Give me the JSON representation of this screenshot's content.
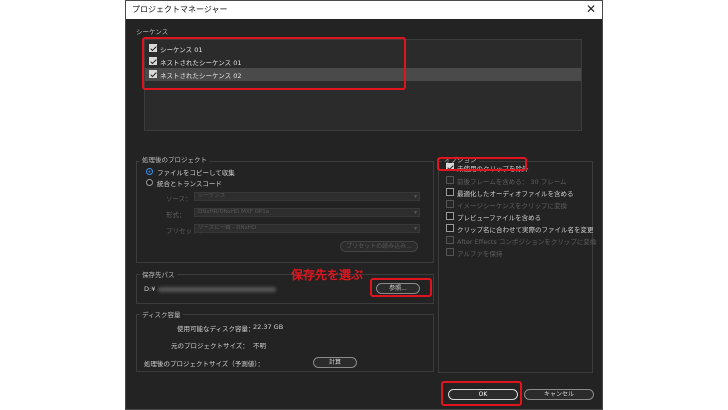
{
  "window": {
    "title": "プロジェクトマネージャー",
    "close_glyph": "✕"
  },
  "sequences": {
    "label": "シーケンス",
    "items": [
      {
        "label": "シーケンス 01",
        "checked": true
      },
      {
        "label": "ネストされたシーケンス 01",
        "checked": true
      },
      {
        "label": "ネストされたシーケンス 02",
        "checked": true,
        "selected": true
      }
    ]
  },
  "processed_project": {
    "label": "処理後のプロジェクト",
    "radio_copy": "ファイルをコピーして収集",
    "radio_consolidate": "統合とトランスコード",
    "source_label": "ソース：",
    "source_value": "シーケンス",
    "format_label": "形式：",
    "format_value": "DNxHR/DNxHD MXF OP1a",
    "preset_label": "プリセット：",
    "preset_value": "ソースに一致 - DNxHD",
    "import_preset_button": "プリセットの読み込み..."
  },
  "options": {
    "label": "オプション",
    "items": [
      {
        "label": "未使用のクリップを除外",
        "checked": true,
        "enabled": true
      },
      {
        "label": "前後フレームを含める：  30 フレーム",
        "checked": false,
        "enabled": false
      },
      {
        "label": "最適化したオーディオファイルを含める",
        "checked": false,
        "enabled": true
      },
      {
        "label": "イメージシーケンスをクリップに変換",
        "checked": false,
        "enabled": false
      },
      {
        "label": "プレビューファイルを含める",
        "checked": false,
        "enabled": true
      },
      {
        "label": "クリップ名に合わせて実際のファイル名を変更",
        "checked": false,
        "enabled": true
      },
      {
        "label": "After Effects コンポジションをクリップに変換",
        "checked": false,
        "enabled": false
      },
      {
        "label": "アルファを保持",
        "checked": false,
        "enabled": false
      }
    ]
  },
  "destination": {
    "label": "保存先パス",
    "path_prefix": "D:¥",
    "browse_button": "参照..."
  },
  "disk_space": {
    "label": "ディスク容量",
    "available_label": "使用可能なディスク容量：",
    "available_value": "22.37 GB",
    "original_label": "元のプロジェクトサイズ：",
    "original_value": "不明",
    "estimated_label": "処理後のプロジェクトサイズ（予測値）：",
    "calculate_button": "計算"
  },
  "footer": {
    "ok_button": "OK",
    "cancel_button": "キャンセル"
  },
  "annotation": {
    "callout_text": "保存先を選ぶ",
    "color": "#e0141e"
  }
}
